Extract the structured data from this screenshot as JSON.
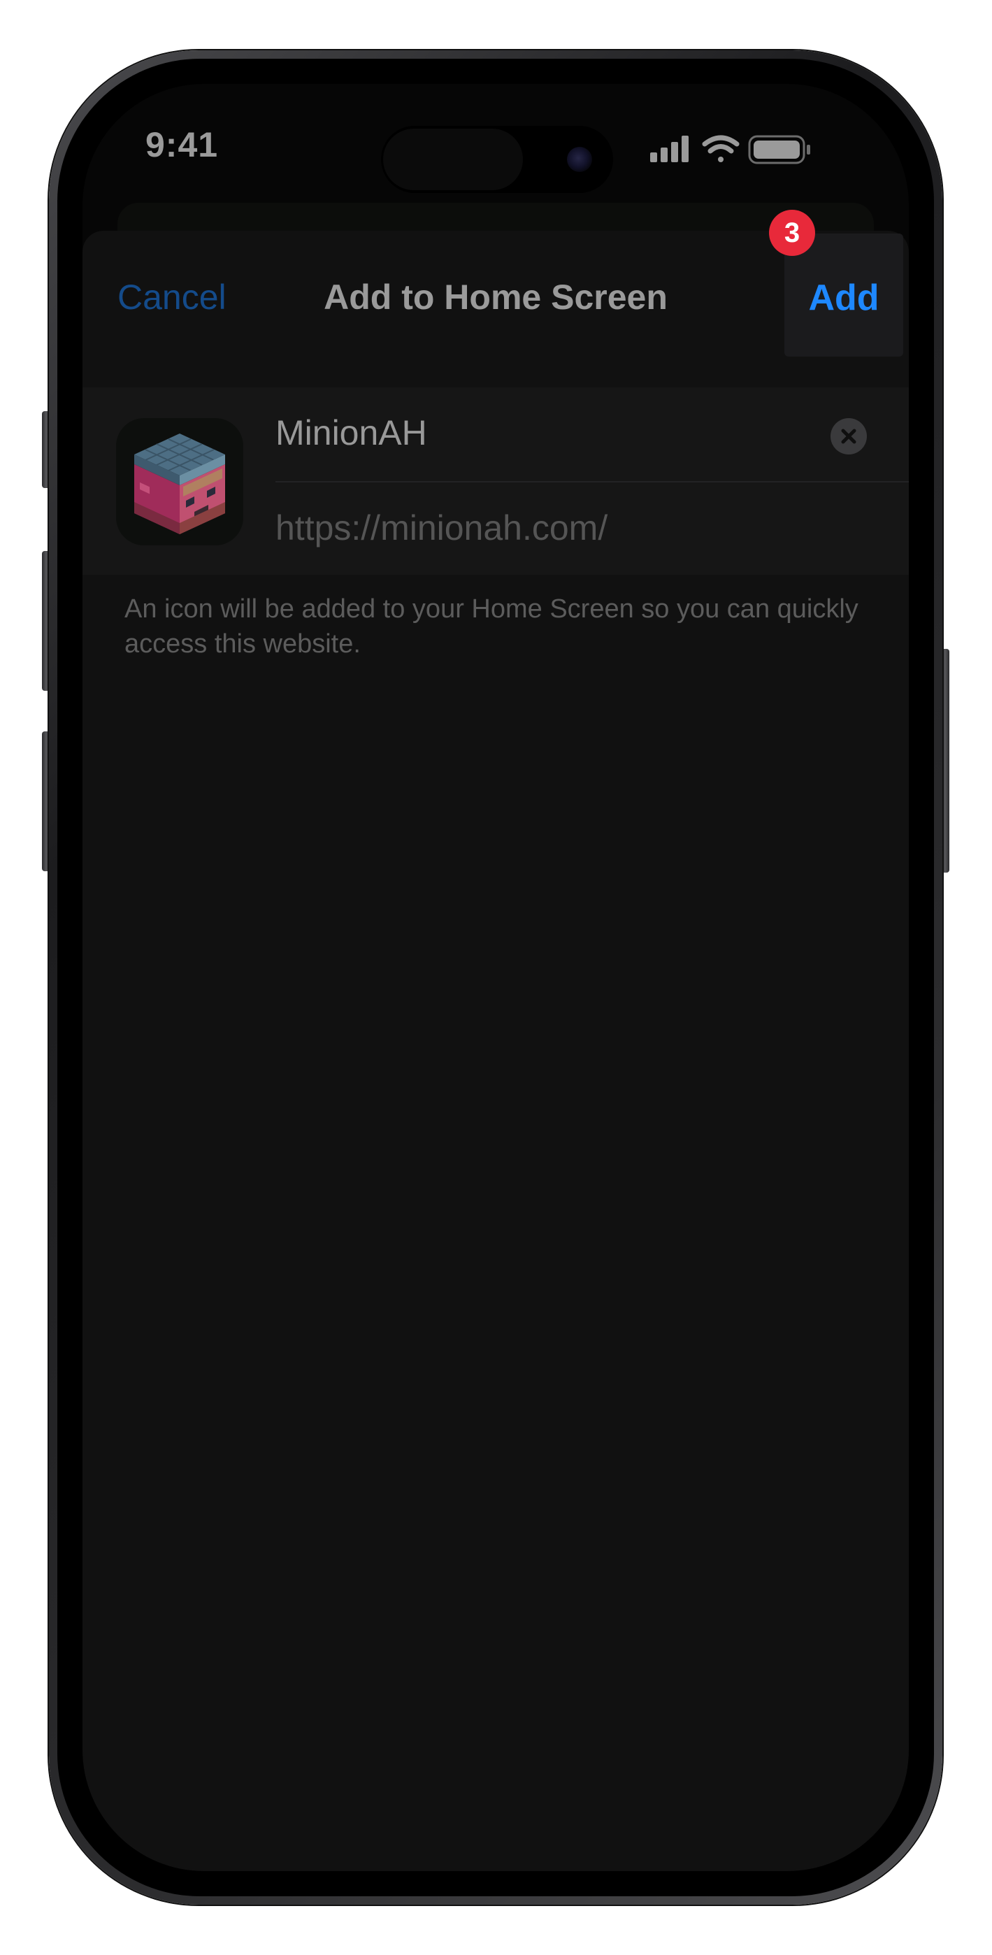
{
  "status_bar": {
    "time": "9:41"
  },
  "sheet": {
    "cancel_label": "Cancel",
    "title": "Add to Home Screen",
    "add_label": "Add",
    "step_badge": "3"
  },
  "form": {
    "app_name": "MinionAH",
    "url": "https://minionah.com/",
    "description": "An icon will be added to your Home Screen so you can quickly access this website."
  },
  "colors": {
    "accent_blue": "#1e88ff",
    "badge_red": "#e8293a",
    "sheet_background": "#111111"
  },
  "icons": {
    "app_icon": "minion-block-icon",
    "clear": "clear-x-icon",
    "signal": "cellular-signal-icon",
    "wifi": "wifi-icon",
    "battery": "battery-icon"
  }
}
